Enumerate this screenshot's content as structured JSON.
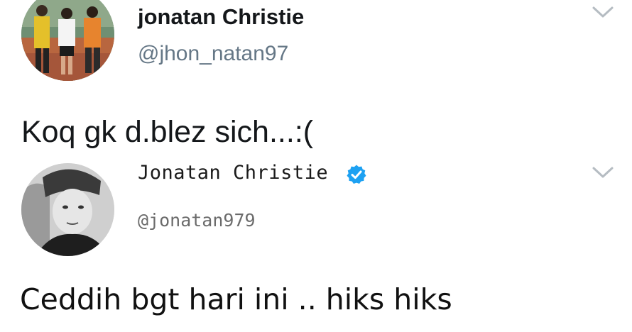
{
  "tweets": [
    {
      "display_name": "jonatan Christie",
      "handle": "@jhon_natan97",
      "text": "Koq gk d.blez sich...:(",
      "verified": false,
      "menu_icon": "chevron-down-icon"
    },
    {
      "display_name": "Jonatan Christie",
      "handle": "@jonatan979",
      "text": "Ceddih bgt hari ini .. hiks hiks",
      "verified": true,
      "menu_icon": "chevron-down-icon"
    }
  ],
  "colors": {
    "verified_blue": "#1da1f2",
    "handle_gray": "#657786",
    "text_dark": "#14171a",
    "chevron_gray": "#b5bcc2"
  }
}
